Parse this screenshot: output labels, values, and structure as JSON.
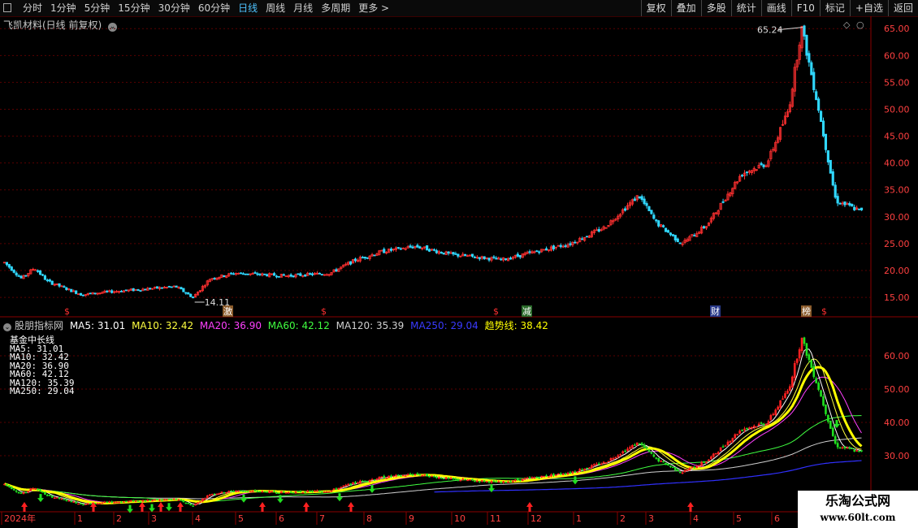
{
  "toolbar": {
    "periods": [
      "分时",
      "1分钟",
      "5分钟",
      "15分钟",
      "30分钟",
      "60分钟",
      "日线",
      "周线",
      "月线",
      "多周期",
      "更多 >"
    ],
    "active_period": "日线",
    "actions": [
      "复权",
      "叠加",
      "多股",
      "统计",
      "画线",
      "F10",
      "标记",
      "+自选",
      "返回"
    ]
  },
  "main_panel": {
    "title": "飞凯材料(日线 前复权)",
    "max_label": "65.24",
    "min_label": "14.11",
    "events": [
      {
        "label": "$",
        "type": "dollar"
      },
      {
        "label": "激",
        "type": "tag"
      },
      {
        "label": "$",
        "type": "dollar"
      },
      {
        "label": "$",
        "type": "dollar"
      },
      {
        "label": "减",
        "type": "tag"
      },
      {
        "label": "财",
        "type": "tag"
      },
      {
        "label": "榜",
        "type": "tag"
      },
      {
        "label": "$",
        "type": "dollar"
      }
    ]
  },
  "indicator_panel": {
    "name": "股朋指标网",
    "ma_items": [
      {
        "label": "MA5: 31.01",
        "color": "#ffffff"
      },
      {
        "label": "MA10: 32.42",
        "color": "#ffff40"
      },
      {
        "label": "MA20: 36.90",
        "color": "#ff40ff"
      },
      {
        "label": "MA60: 42.12",
        "color": "#40ff40"
      },
      {
        "label": "MA120: 35.39",
        "color": "#d0d0d0"
      },
      {
        "label": "MA250: 29.04",
        "color": "#3a3aff"
      },
      {
        "label": "趋势线: 38.42",
        "color": "#ffff00"
      }
    ],
    "legend_title": "基金中长线",
    "legend_lines": [
      "MA5:   31.01",
      "MA10:  32.42",
      "MA20:  36.90",
      "MA60:  42.12",
      "MA120: 35.39",
      "MA250: 29.04"
    ]
  },
  "chart_data": {
    "type": "candlestick",
    "title": "飞凯材料(日线 前复权)",
    "main_y_ticks": [
      "65.00",
      "60.00",
      "55.00",
      "50.00",
      "45.00",
      "40.00",
      "35.00",
      "30.00",
      "25.00",
      "20.00",
      "15.00"
    ],
    "indicator_y_ticks": [
      "60.00",
      "50.00",
      "40.00",
      "30.00"
    ],
    "ylim": [
      13.5,
      67
    ],
    "x_labels": [
      "2024年",
      "1",
      "2",
      "3",
      "4",
      "5",
      "6",
      "7",
      "8",
      "9",
      "10",
      "11",
      "12",
      "1",
      "2",
      "3",
      "4",
      "5",
      "6"
    ],
    "price_path": [
      [
        0,
        21.5
      ],
      [
        0.02,
        18.5
      ],
      [
        0.035,
        20.5
      ],
      [
        0.05,
        18.0
      ],
      [
        0.09,
        15.5
      ],
      [
        0.12,
        16.0
      ],
      [
        0.16,
        16.5
      ],
      [
        0.2,
        17.0
      ],
      [
        0.22,
        15.0
      ],
      [
        0.24,
        18.5
      ],
      [
        0.27,
        19.5
      ],
      [
        0.33,
        19.0
      ],
      [
        0.38,
        19.5
      ],
      [
        0.41,
        22.0
      ],
      [
        0.44,
        23.5
      ],
      [
        0.48,
        24.5
      ],
      [
        0.52,
        23.0
      ],
      [
        0.55,
        22.5
      ],
      [
        0.58,
        22.0
      ],
      [
        0.62,
        23.5
      ],
      [
        0.66,
        25.0
      ],
      [
        0.7,
        28.0
      ],
      [
        0.74,
        34.0
      ],
      [
        0.76,
        29.0
      ],
      [
        0.79,
        25.0
      ],
      [
        0.82,
        28.5
      ],
      [
        0.86,
        38.0
      ],
      [
        0.89,
        40.0
      ],
      [
        0.915,
        50.0
      ],
      [
        0.93,
        65.24
      ],
      [
        0.95,
        50.0
      ],
      [
        0.97,
        33.0
      ],
      [
        1.0,
        31.0
      ]
    ]
  },
  "colors": {
    "up": "#ff3030",
    "down": "#30d8ff",
    "grid": "#5a0000",
    "frame": "#8a0000",
    "axis_text": "#ff4040"
  },
  "watermark": {
    "line1": "乐淘公式网",
    "line2": "www.60lt.com"
  }
}
